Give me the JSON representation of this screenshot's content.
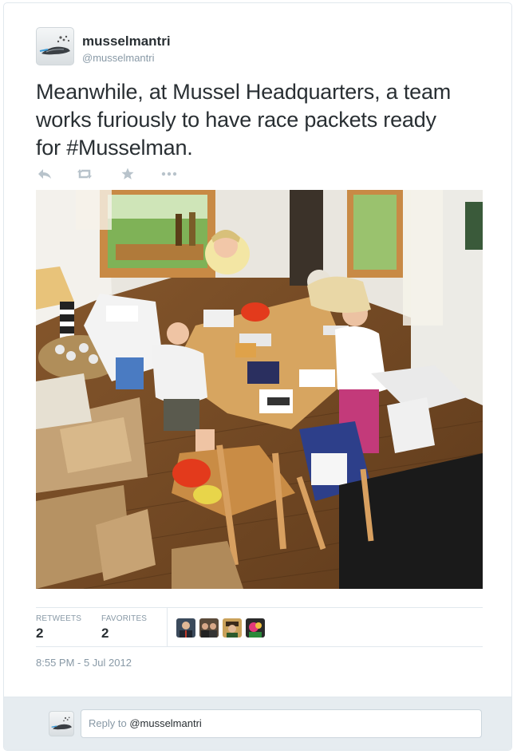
{
  "user": {
    "display_name": "musselmantri",
    "handle": "@musselmantri"
  },
  "tweet": {
    "text_lines": [
      "Meanwhile, at Mussel Headquarters, a team",
      "works furiously to have race packets ready",
      "for #Musselman."
    ],
    "timestamp": "8:55 PM - 5 Jul 2012"
  },
  "actions": [
    {
      "icon": "reply-icon"
    },
    {
      "icon": "retweet-icon"
    },
    {
      "icon": "favorite-star-icon"
    },
    {
      "icon": "more-icon"
    }
  ],
  "stats": {
    "retweets_label": "RETWEETS",
    "retweets_count": "2",
    "favorites_label": "FAVORITES",
    "favorites_count": "2"
  },
  "reply": {
    "prefix": "Reply to ",
    "mention": "@musselmantri"
  },
  "colors": {
    "text": "#292f33",
    "muted": "#8899a6",
    "border": "#e1e8ed",
    "reply_bar": "#e6ecf0"
  }
}
